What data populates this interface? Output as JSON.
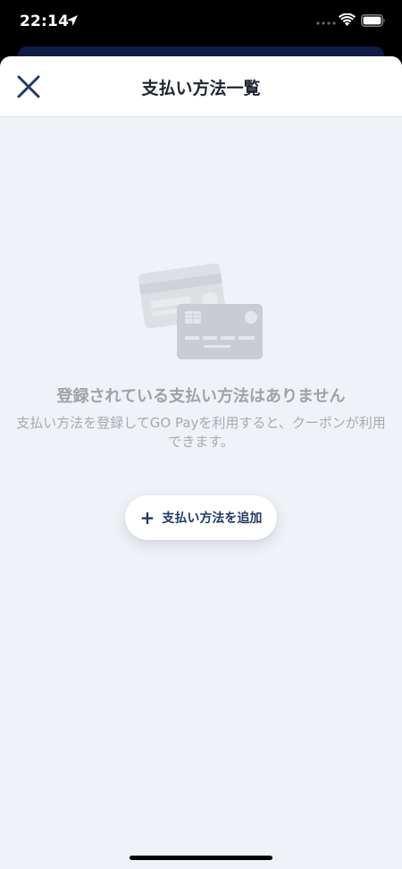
{
  "status_bar": {
    "time": "22:14"
  },
  "header": {
    "title": "支払い方法一覧"
  },
  "empty_state": {
    "title": "登録されている支払い方法はありません",
    "description": "支払い方法を登録してGO Payを利用すると、クーポンが利用できます。"
  },
  "actions": {
    "add_plus": "+",
    "add_label": "支払い方法を追加"
  },
  "colors": {
    "sheet_background": "#eff2f6",
    "accent": "#1e3a66",
    "muted_text": "#9ea3a9"
  },
  "icons": {
    "close": "close-icon",
    "location": "location-arrow-icon",
    "wifi": "wifi-icon",
    "battery": "battery-icon",
    "cards": "credit-cards-icon"
  }
}
